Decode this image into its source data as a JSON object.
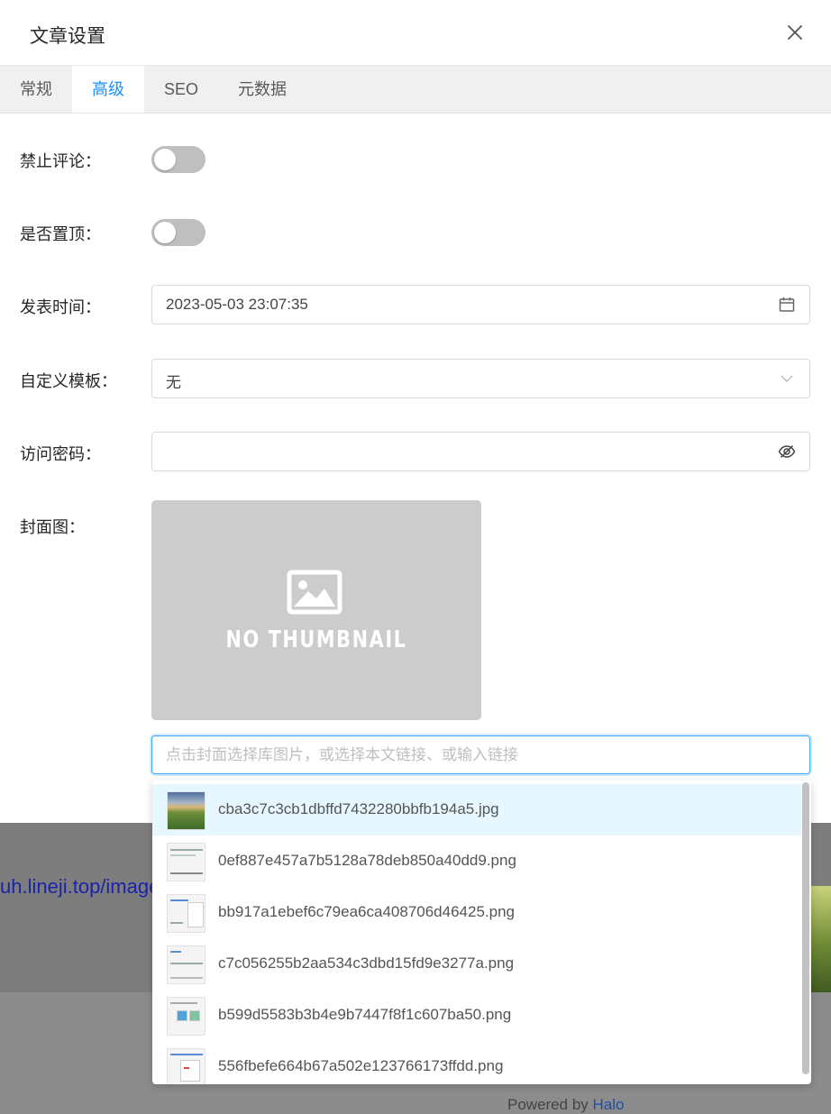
{
  "background": {
    "link_text": "uh.lineji.top/image",
    "powered_prefix": "Powered by",
    "powered_brand": "Halo"
  },
  "modal": {
    "title": "文章设置",
    "close_icon": "close-icon"
  },
  "tabs": [
    {
      "label": "常规",
      "active": false
    },
    {
      "label": "高级",
      "active": true
    },
    {
      "label": "SEO",
      "active": false
    },
    {
      "label": "元数据",
      "active": false
    }
  ],
  "form": {
    "disable_comments": {
      "label": "禁止评论：",
      "checked": false
    },
    "top_priority": {
      "label": "是否置顶：",
      "checked": false
    },
    "publish_time": {
      "label": "发表时间：",
      "value": "2023-05-03 23:07:35",
      "icon": "calendar-icon"
    },
    "custom_template": {
      "label": "自定义模板：",
      "value": "无",
      "icon": "chevron-down-icon"
    },
    "password": {
      "label": "访问密码：",
      "value": "",
      "icon": "eye-invisible-icon"
    },
    "cover": {
      "label": "封面图：",
      "placeholder_text": "NO THUMBNAIL",
      "input_placeholder": "点击封面选择库图片，或选择本文链接、或输入链接",
      "input_value": ""
    }
  },
  "dropdown": {
    "items": [
      {
        "name": "cba3c7c3cb1dbffd7432280bbfb194a5.jpg",
        "highlighted": true
      },
      {
        "name": "0ef887e457a7b5128a78deb850a40dd9.png",
        "highlighted": false
      },
      {
        "name": "bb917a1ebef6c79ea6ca408706d46425.png",
        "highlighted": false
      },
      {
        "name": "c7c056255b2aa534c3dbd15fd9e3277a.png",
        "highlighted": false
      },
      {
        "name": "b599d5583b3b4e9b7447f8f1c607ba50.png",
        "highlighted": false
      },
      {
        "name": "556fbefe664b67a502e123766173ffdd.png",
        "highlighted": false
      }
    ]
  },
  "colors": {
    "accent": "#1890ff",
    "switch_off": "#bfbfbf",
    "highlight_row": "#e6f7ff",
    "thumbnail_bg": "#cccccc"
  }
}
